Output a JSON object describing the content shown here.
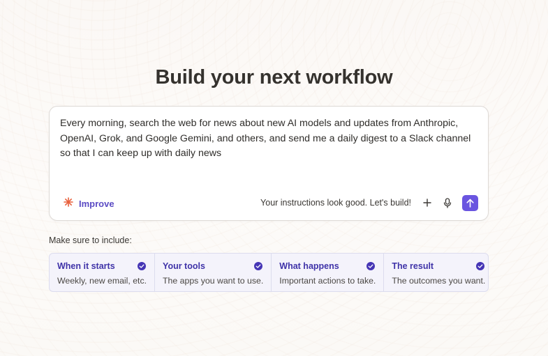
{
  "page": {
    "title": "Build your next workflow"
  },
  "prompt": {
    "text": "Every morning, search the web for news about new AI models and updates from Anthropic, OpenAI, Grok, and Google Gemini, and others, and send me a daily digest to a Slack channel so that I can keep up with daily news",
    "improve_label": "Improve",
    "status": "Your instructions look good. Let's build!",
    "icons": {
      "improve": "sparkle-icon",
      "add": "plus-icon",
      "voice": "microphone-icon",
      "send": "arrow-up-icon"
    }
  },
  "include": {
    "label": "Make sure to include:",
    "items": [
      {
        "title": "When it starts",
        "subtitle": "Weekly, new email, etc.",
        "checked": true
      },
      {
        "title": "Your tools",
        "subtitle": "The apps you want to use.",
        "checked": true
      },
      {
        "title": "What happens",
        "subtitle": "Important actions to take.",
        "checked": true
      },
      {
        "title": "The result",
        "subtitle": "The outcomes you want.",
        "checked": true
      }
    ]
  },
  "colors": {
    "accent": "#6a55e0",
    "accent_text": "#3f33a8",
    "sparkle": "#e8603c",
    "checklist_bg": "#f4f3fb"
  }
}
